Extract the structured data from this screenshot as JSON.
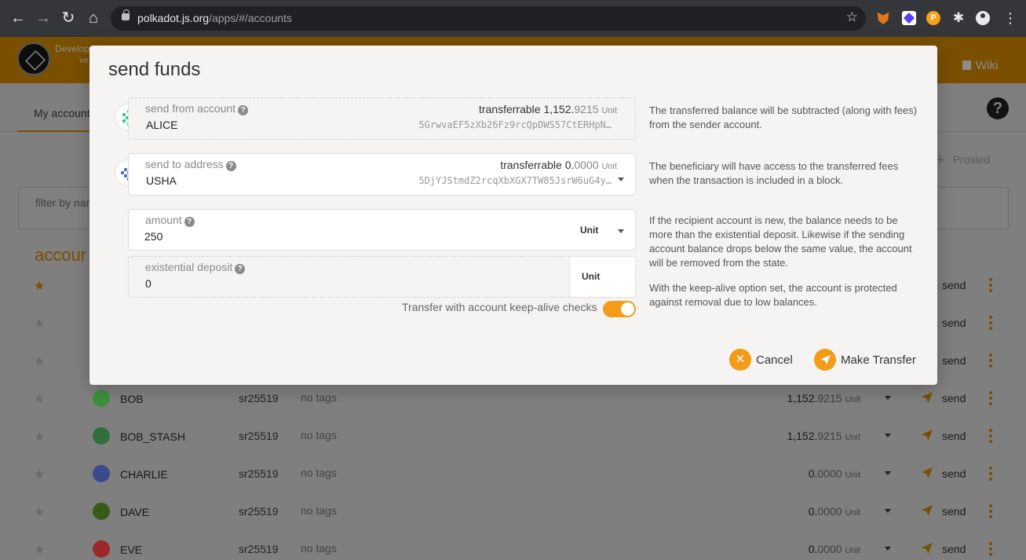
{
  "browser": {
    "url_domain": "polkadot.js.org",
    "url_path": "/apps/#/accounts"
  },
  "header": {
    "chain_name": "Develop",
    "chain_version": "ve",
    "wiki_label": "Wiki"
  },
  "subnav": {
    "active_tab": "My account"
  },
  "toolbar": {
    "proxied_label": "Proxied"
  },
  "filter": {
    "label": "filter by nar"
  },
  "accounts_title": "accour",
  "accounts": [
    {
      "name": "",
      "type": "",
      "tags": "",
      "balance_int": "",
      "balance_frac": "",
      "unit": "",
      "send": "send",
      "fav": true,
      "avatar_color": "#4a6a4a"
    },
    {
      "name": "",
      "type": "",
      "tags": "",
      "balance_int": "",
      "balance_frac": "",
      "unit": "",
      "send": "send",
      "fav": false,
      "avatar_color": "#4a5a6a"
    },
    {
      "name": "",
      "type": "",
      "tags": "",
      "balance_int": "",
      "balance_frac": "",
      "unit": "",
      "send": "send",
      "fav": false,
      "avatar_color": "#5a4a6a"
    },
    {
      "name": "BOB",
      "type": "sr25519",
      "tags": "no tags",
      "balance_int": "1,152.",
      "balance_frac": "9215",
      "unit": "Unit",
      "send": "send",
      "fav": false,
      "avatar_color": "#3d8f3d"
    },
    {
      "name": "BOB_STASH",
      "type": "sr25519",
      "tags": "no tags",
      "balance_int": "1,152.",
      "balance_frac": "9215",
      "unit": "Unit",
      "send": "send",
      "fav": false,
      "avatar_color": "#2e6f3a"
    },
    {
      "name": "CHARLIE",
      "type": "sr25519",
      "tags": "no tags",
      "balance_int": "0.",
      "balance_frac": "0000",
      "unit": "Unit",
      "send": "send",
      "fav": false,
      "avatar_color": "#3b4a8a"
    },
    {
      "name": "DAVE",
      "type": "sr25519",
      "tags": "no tags",
      "balance_int": "0.",
      "balance_frac": "0000",
      "unit": "Unit",
      "send": "send",
      "fav": false,
      "avatar_color": "#3a5a1a"
    },
    {
      "name": "EVE",
      "type": "sr25519",
      "tags": "no tags",
      "balance_int": "0.",
      "balance_frac": "0000",
      "unit": "Unit",
      "send": "send",
      "fav": false,
      "avatar_color": "#9a2a2a"
    }
  ],
  "modal": {
    "title": "send funds",
    "from": {
      "label": "send from account",
      "name": "ALICE",
      "address": "5GrwvaEF5zXb26Fz9rcQpDWS57CtERHpN…",
      "transferrable_label": "transferrable",
      "balance_int": "1,152.",
      "balance_frac": "9215",
      "unit": "Unit"
    },
    "to": {
      "label": "send to address",
      "name": "USHA",
      "address": "5DjYJStmdZ2rcqXbXGX7TW85JsrW6uG4y…",
      "transferrable_label": "transferrable",
      "balance_int": "0.",
      "balance_frac": "0000",
      "unit": "Unit"
    },
    "amount": {
      "label": "amount",
      "value": "250",
      "unit": "Unit"
    },
    "deposit": {
      "label": "existential deposit",
      "value": "0",
      "unit": "Unit"
    },
    "keepalive_label": "Transfer with account keep-alive checks",
    "keepalive_on": true,
    "help": {
      "from": "The transferred balance will be subtracted (along with fees) from the sender account.",
      "to": "The beneficiary will have access to the transferred fees when the transaction is included in a block.",
      "amount": "If the recipient account is new, the balance needs to be more than the existential deposit. Likewise if the sending account balance drops below the same value, the account will be removed from the state.",
      "keepalive": "With the keep-alive option set, the account is protected against removal due to low balances."
    },
    "cancel_label": "Cancel",
    "transfer_label": "Make Transfer"
  },
  "colors": {
    "accent": "#f29c18",
    "accent_dimmed": "#7a4f00"
  }
}
